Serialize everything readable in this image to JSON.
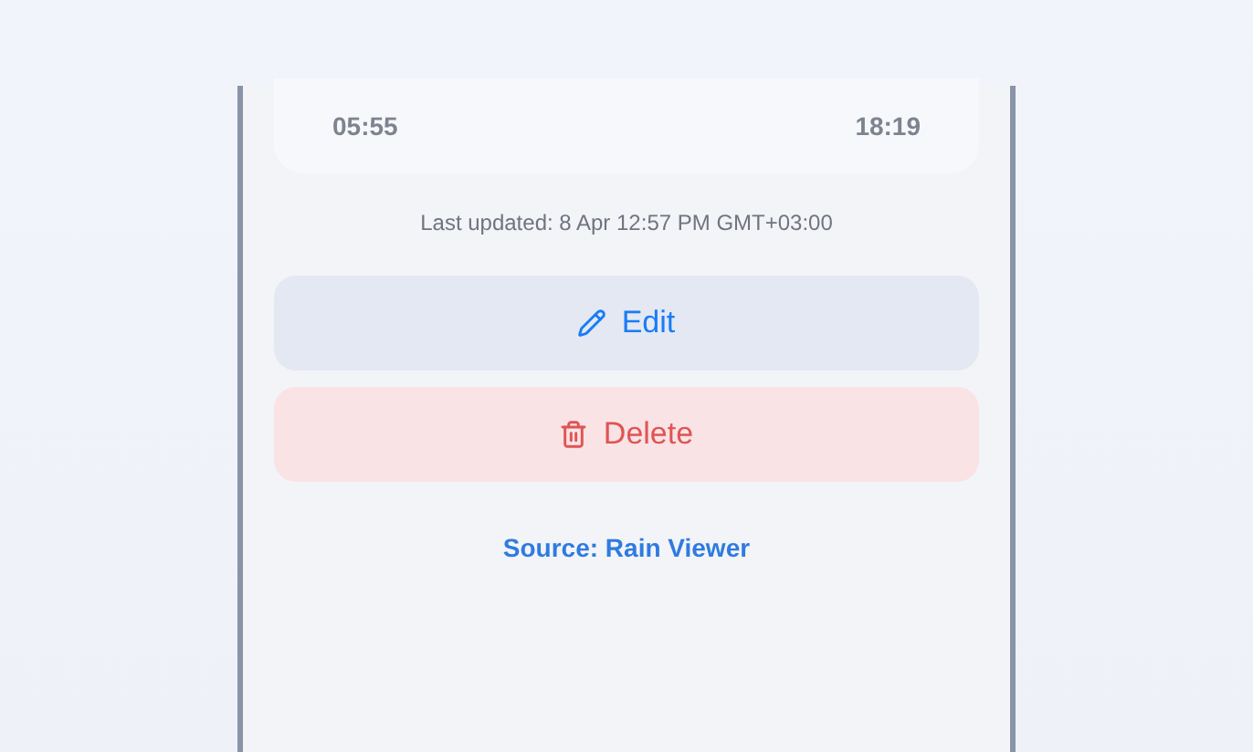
{
  "times_card": {
    "start_time": "05:55",
    "end_time": "18:19"
  },
  "last_updated": "Last updated: 8 Apr 12:57 PM GMT+03:00",
  "buttons": [
    {
      "kind": "edit",
      "label": "Edit"
    },
    {
      "kind": "delete",
      "label": "Delete"
    }
  ],
  "source_link": "Source: Rain Viewer"
}
